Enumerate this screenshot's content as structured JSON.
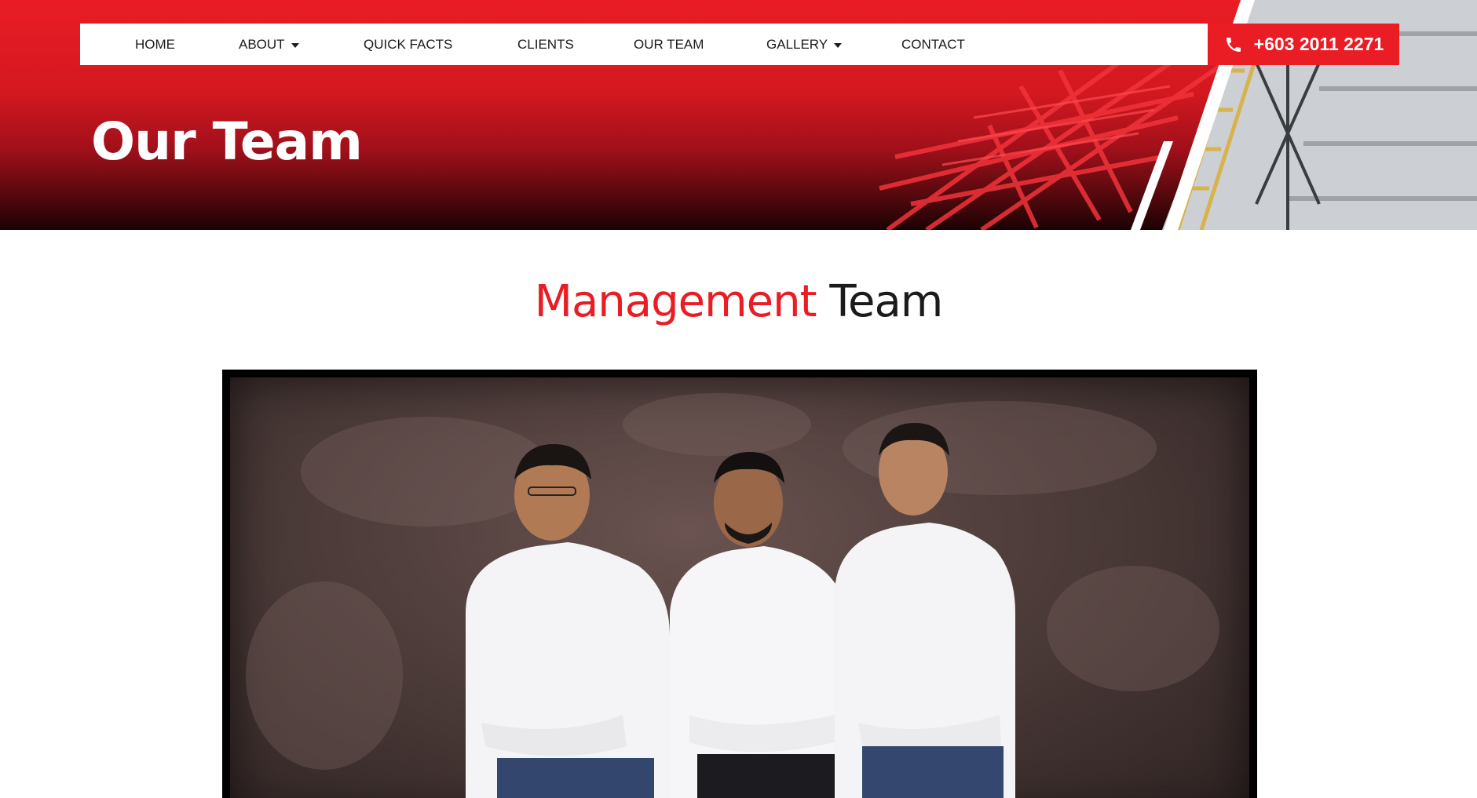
{
  "nav": {
    "items": [
      {
        "label": "HOME",
        "has_dropdown": false
      },
      {
        "label": "ABOUT",
        "has_dropdown": true
      },
      {
        "label": "QUICK FACTS",
        "has_dropdown": false
      },
      {
        "label": "CLIENTS",
        "has_dropdown": false
      },
      {
        "label": "OUR TEAM",
        "has_dropdown": false
      },
      {
        "label": "GALLERY",
        "has_dropdown": true
      },
      {
        "label": "CONTACT",
        "has_dropdown": false
      }
    ],
    "phone": {
      "label": "+603 2011 2271",
      "icon": "phone-icon"
    }
  },
  "hero": {
    "title": "Our Team"
  },
  "section": {
    "title_accent": "Management",
    "title_rest": "Team"
  },
  "colors": {
    "brand_red": "#ea1c24",
    "text_dark": "#1b1b1b",
    "white": "#ffffff"
  }
}
